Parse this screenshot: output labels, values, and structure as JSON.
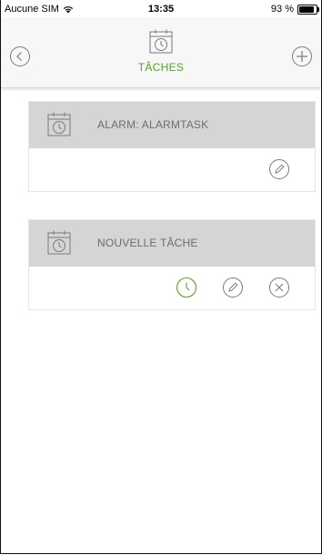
{
  "status_bar": {
    "carrier": "Aucune SIM",
    "time": "13:35",
    "battery": "93 %",
    "battery_level": 0.93
  },
  "header": {
    "title": "TÂCHES",
    "title_icon": "calendar-clock-icon",
    "left_icon": "back-chevron-icon",
    "right_icon": "add-plus-icon"
  },
  "tasks": [
    {
      "name": "ALARM: ALARMTASK",
      "icon": "calendar-clock-icon",
      "actions": [
        "edit-pencil-icon"
      ]
    },
    {
      "name": "NOUVELLE TÂCHE",
      "icon": "calendar-clock-icon",
      "actions": [
        "clock-icon",
        "edit-pencil-icon",
        "delete-x-icon"
      ]
    }
  ],
  "colors": {
    "accent": "#5aa02c",
    "header_bg": "#f7f7f7",
    "card_head_bg": "#d5d5d5",
    "icon_gray": "#7a7a7a"
  }
}
